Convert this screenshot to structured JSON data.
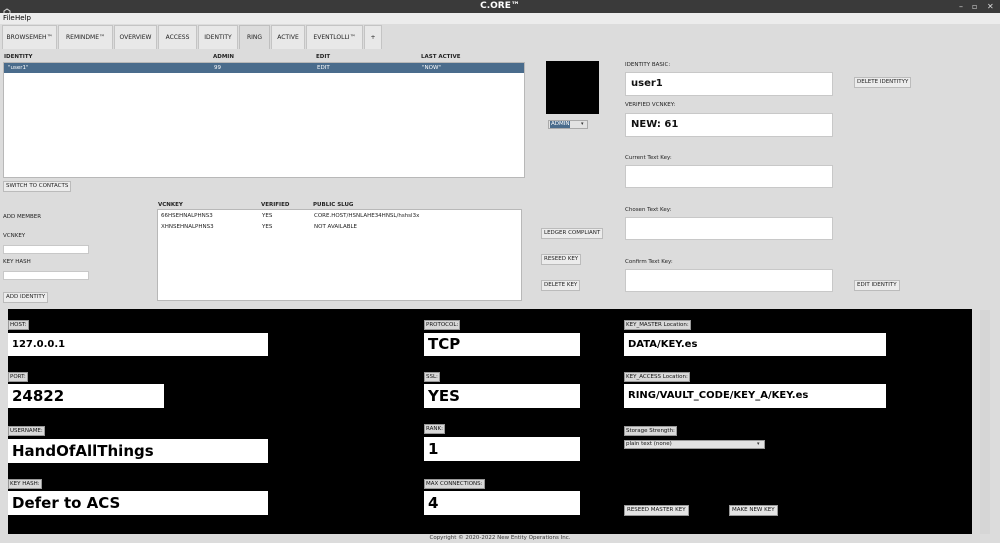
{
  "window": {
    "title": "C.ORE™",
    "minimize": "–",
    "maximize": "▫",
    "close": "✕"
  },
  "menu": {
    "file": "File",
    "help": "Help"
  },
  "tabs": [
    {
      "label": "BROWSEMEH™"
    },
    {
      "label": "REMINDME™"
    },
    {
      "label": "OVERVIEW"
    },
    {
      "label": "ACCESS"
    },
    {
      "label": "IDENTITY"
    },
    {
      "label": "RING"
    },
    {
      "label": "ACTIVE"
    },
    {
      "label": "EVENTLOLLI™"
    },
    {
      "label": "+"
    }
  ],
  "identity_table": {
    "headers": [
      "IDENTITY",
      "ADMIN",
      "EDIT",
      "LAST ACTIVE"
    ],
    "rows": [
      {
        "identity": "\"user1\"",
        "admin": "99",
        "edit": "EDIT",
        "last_active": "\"NOW\""
      }
    ]
  },
  "switch_button": "SWITCH TO CONTACTS",
  "add_member": {
    "title": "ADD MEMBER",
    "vcnkey_label": "VCNKEY",
    "keyhash_label": "KEY HASH",
    "add_button": "ADD IDENTITY"
  },
  "vcn_table": {
    "headers": [
      "VCNKEY",
      "VERIFIED",
      "PUBLIC SLUG"
    ],
    "rows": [
      {
        "key": "66HSEHNALPHNS3",
        "verified": "YES",
        "slug": "CORE.HOST/HSNLAHE34HNSL/hshsl3x"
      },
      {
        "key": "XHNSEHNALPHNS3",
        "verified": "YES",
        "slug": "NOT AVAILABLE"
      }
    ]
  },
  "avatar_select": "ADMIN",
  "middle_buttons": {
    "ledger": "LEDGER COMPLIANT",
    "reseed": "RESEED KEY",
    "delete": "DELETE KEY"
  },
  "identity_form": {
    "basic_label": "IDENTITY BASIC:",
    "basic_value": "user1",
    "verified_label": "VERIFIED VCNKEY:",
    "verified_value": "NEW: 61",
    "current_label": "Current Text Key:",
    "chosen_label": "Chosen Text Key:",
    "confirm_label": "Confirm Text Key:",
    "delete_button": "DELETE IDENTITYY",
    "edit_button": "EDIT IDENTITY"
  },
  "connection": {
    "host_label": "HOST:",
    "host_value": "127.0.0.1",
    "port_label": "PORT:",
    "port_value": "24822",
    "username_label": "USERNAME:",
    "username_value": "HandOfAllThings",
    "keyhash_label": "KEY HASH:",
    "keyhash_value": "Defer to ACS",
    "protocol_label": "PROTOCOL:",
    "protocol_value": "TCP",
    "ssl_label": "SSL:",
    "ssl_value": "YES",
    "rank_label": "RANK:",
    "rank_value": "1",
    "maxconn_label": "MAX CONNECTIONS:",
    "maxconn_value": "4",
    "keymaster_label": "KEY_MASTER Location:",
    "keymaster_value": "DATA/KEY.es",
    "keyaccess_label": "KEY_ACCESS Location:",
    "keyaccess_value": "RING/VAULT_CODE/KEY_A/KEY.es",
    "storage_label": "Storage Strength:",
    "storage_value": "plain text (none)",
    "reseed_master": "RESEED MASTER KEY",
    "make_new_key": "MAKE NEW KEY"
  },
  "footer": "Copyright © 2020-2022 New Entity Operations Inc."
}
